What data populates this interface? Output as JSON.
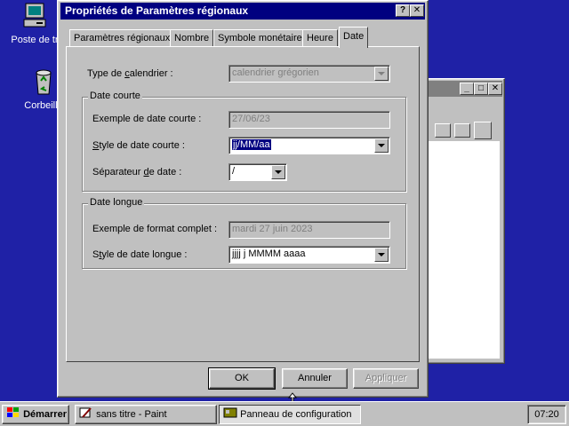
{
  "desktop": {
    "icons": [
      {
        "label": "Poste de tr",
        "icon": "computer-icon"
      },
      {
        "label": "Corbeille",
        "icon": "recycle-bin-icon"
      }
    ]
  },
  "dialog": {
    "title": "Propriétés de Paramètres régionaux",
    "help_glyph": "?",
    "close_glyph": "✕",
    "tabs": [
      "Paramètres régionaux",
      "Nombre",
      "Symbole monétaire",
      "Heure",
      "Date"
    ],
    "active_tab": "Date",
    "calendar": {
      "label": "Type de calendrier :",
      "value": "calendrier grégorien"
    },
    "short_date": {
      "legend": "Date courte",
      "example_label": "Exemple de date courte :",
      "example_value": "27/06/23",
      "style_label": "Style de date courte :",
      "style_value": "jj/MM/aa",
      "separator_label": "Séparateur de date :",
      "separator_value": "/"
    },
    "long_date": {
      "legend": "Date longue",
      "example_label": "Exemple de format complet :",
      "example_value": "mardi 27 juin 2023",
      "style_label": "Style de date longue :",
      "style_value": "jjjj j MMMM aaaa"
    },
    "buttons": {
      "ok": "OK",
      "cancel": "Annuler",
      "apply": "Appliquer"
    }
  },
  "taskbar": {
    "start": "Démarrer",
    "tasks": [
      {
        "label": "sans titre - Paint",
        "pressed": false
      },
      {
        "label": "Panneau de configuration",
        "pressed": true
      }
    ],
    "clock": "07:20"
  }
}
